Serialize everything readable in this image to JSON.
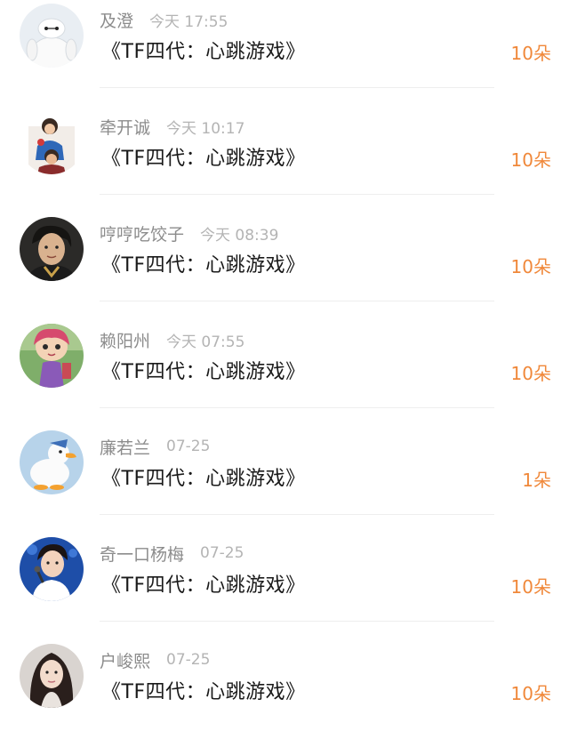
{
  "entries": [
    {
      "username": "及澄",
      "time": "今天 17:55",
      "title": "《TF四代：心跳游戏》",
      "gift": "10朵",
      "avatar_icon": "baymax-avatar-icon"
    },
    {
      "username": "牵开诚",
      "time": "今天 10:17",
      "title": "《TF四代：心跳游戏》",
      "gift": "10朵",
      "avatar_icon": "kids-photo-avatar-icon"
    },
    {
      "username": "哼哼吃饺子",
      "time": "今天 08:39",
      "title": "《TF四代：心跳游戏》",
      "gift": "10朵",
      "avatar_icon": "boy-portrait-avatar-icon"
    },
    {
      "username": "赖阳州",
      "time": "今天 07:55",
      "title": "《TF四代：心跳游戏》",
      "gift": "10朵",
      "avatar_icon": "cartoon-girl-avatar-icon"
    },
    {
      "username": "廉若兰",
      "time": "07-25",
      "title": "《TF四代：心跳游戏》",
      "gift": "1朵",
      "avatar_icon": "duck-avatar-icon"
    },
    {
      "username": "奇一口杨梅",
      "time": "07-25",
      "title": "《TF四代：心跳游戏》",
      "gift": "10朵",
      "avatar_icon": "singer-avatar-icon"
    },
    {
      "username": "户峻熙",
      "time": "07-25",
      "title": "《TF四代：心跳游戏》",
      "gift": "10朵",
      "avatar_icon": "girl-portrait-avatar-icon"
    }
  ],
  "colors": {
    "accent": "#f0883a",
    "username": "#8c8c8c",
    "time": "#b4b4b4",
    "title": "#1a1a1a",
    "divider": "#eeeeee"
  }
}
